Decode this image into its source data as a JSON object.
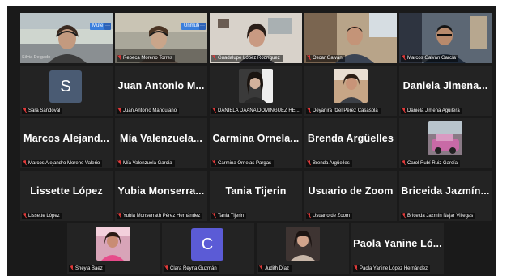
{
  "participants": {
    "row1": [
      {
        "name": "Silvia Delgado",
        "button": "Mute",
        "dots": "···"
      },
      {
        "name": "Rebeca Moreno Torres",
        "button": "Unmute",
        "dots": "···"
      },
      {
        "name": "Guadalupe López Rodríguez"
      },
      {
        "name": "Oscar Galván"
      },
      {
        "name": "Marcos Galván García"
      }
    ],
    "row2": [
      {
        "initial": "S",
        "name": "Sara Sandoval"
      },
      {
        "display": "Juan Antonio M...",
        "name": "Juan Antonio Mandujano"
      },
      {
        "name": "DANIELA DAANA DOMINGUEZ HE..."
      },
      {
        "name": "Deyanira Itzel Pérez Casasola"
      },
      {
        "display": "Daniela Jimena...",
        "name": "Daniela Jimena Aguilera"
      }
    ],
    "row3": [
      {
        "display": "Marcos Alejand...",
        "name": "Marcos Alejandro Moreno Valerio"
      },
      {
        "display": "Mía Valenzuela...",
        "name": "Mía Valenzuela García"
      },
      {
        "display": "Carmina Ornela...",
        "name": "Carmina Ornelas Pargas"
      },
      {
        "display": "Brenda Argüelles",
        "name": "Brenda Argüelles"
      },
      {
        "name": "Carol Rubí Ruiz García"
      }
    ],
    "row4": [
      {
        "display": "Lissette López",
        "name": "Lissette López"
      },
      {
        "display": "Yubia Monserra...",
        "name": "Yubia Monserrath Pérez Hernández"
      },
      {
        "display": "Tania Tijerin",
        "name": "Tania Tijerin"
      },
      {
        "display": "Usuario de Zoom",
        "name": "Usuario de Zoom"
      },
      {
        "display": "Briceida Jazmín...",
        "name": "Briceida Jazmín Najar Villegas"
      }
    ],
    "row5": [
      {
        "name": "Sheyla Baez"
      },
      {
        "initial": "C",
        "name": "Clara Reyna Guzmán"
      },
      {
        "name": "Judith Díaz"
      },
      {
        "display": "Paola Yanine Ló...",
        "name": "Paola Yanine López Hernández"
      }
    ]
  },
  "colors": {
    "background": "#1a1a1a",
    "tile": "#232323",
    "active_border": "#59d37a",
    "muted_mic": "#e03a3a",
    "button": "#3a7fdc"
  }
}
